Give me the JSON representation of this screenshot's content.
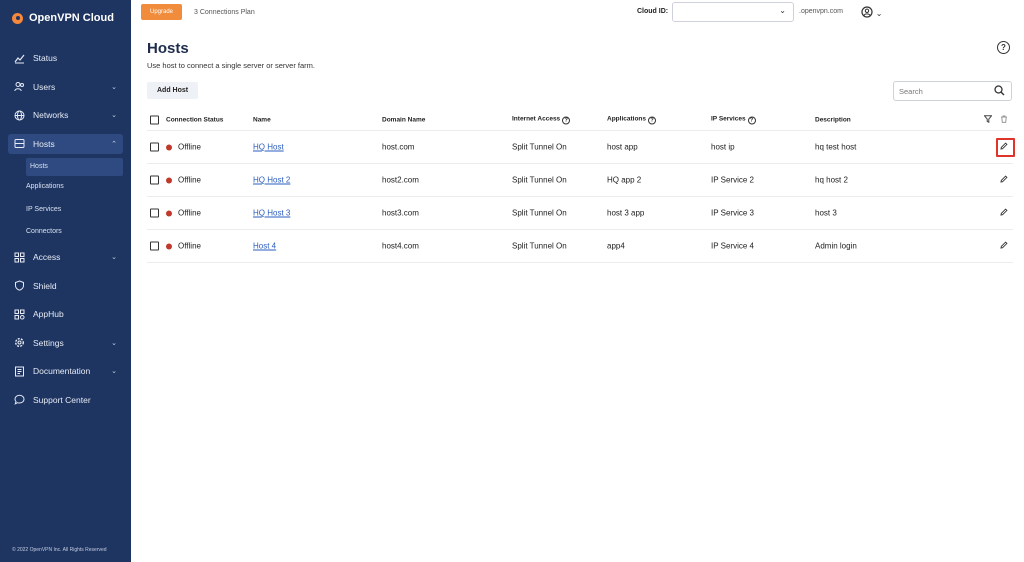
{
  "sidebar": {
    "brand": "OpenVPN Cloud",
    "items": [
      {
        "label": "Status",
        "icon": "chart-icon"
      },
      {
        "label": "Users",
        "icon": "users-icon"
      },
      {
        "label": "Networks",
        "icon": "globe-icon"
      },
      {
        "label": "Hosts",
        "icon": "server-icon"
      },
      {
        "label": "Access",
        "icon": "grid-icon"
      },
      {
        "label": "Shield",
        "icon": "shield-icon"
      },
      {
        "label": "AppHub",
        "icon": "apps-icon"
      },
      {
        "label": "Settings",
        "icon": "gear-icon"
      },
      {
        "label": "Documentation",
        "icon": "book-icon"
      },
      {
        "label": "Support Center",
        "icon": "chat-icon"
      }
    ],
    "hosts_sub": [
      "Hosts",
      "Applications",
      "IP Services",
      "Connectors"
    ],
    "copyright": "© 2022 OpenVPN Inc. All Rights Reserved"
  },
  "topbar": {
    "upgrade": "Upgrade",
    "plan": "3 Connections Plan",
    "cloud_id_label": "Cloud ID:",
    "cloud_id_value": "",
    "domain": ".openvpn.com"
  },
  "page": {
    "title": "Hosts",
    "subtitle": "Use host to connect a single server or server farm.",
    "add_host": "Add Host",
    "search_placeholder": "Search"
  },
  "table": {
    "columns": [
      "Connection Status",
      "Name",
      "Domain Name",
      "Internet Access",
      "Applications",
      "IP Services",
      "Description"
    ],
    "rows": [
      {
        "status": "Offline",
        "name": "HQ Host",
        "domain": "host.com",
        "internet": "Split Tunnel On",
        "apps": "host app",
        "ip": "host ip",
        "desc": "hq test host"
      },
      {
        "status": "Offline",
        "name": "HQ Host 2",
        "domain": "host2.com",
        "internet": "Split Tunnel On",
        "apps": "HQ app 2",
        "ip": "IP Service 2",
        "desc": "hq host 2"
      },
      {
        "status": "Offline",
        "name": "HQ Host 3",
        "domain": "host3.com",
        "internet": "Split Tunnel On",
        "apps": "host 3 app",
        "ip": "IP Service 3",
        "desc": "host 3"
      },
      {
        "status": "Offline",
        "name": "Host 4",
        "domain": "host4.com",
        "internet": "Split Tunnel On",
        "apps": "app4",
        "ip": "IP Service 4",
        "desc": "Admin login"
      }
    ]
  },
  "colors": {
    "sidebar_bg": "#1f3561",
    "accent": "#f08c3b",
    "offline": "#c0392b",
    "link": "#2a5cbf",
    "highlight": "#e0342b"
  }
}
